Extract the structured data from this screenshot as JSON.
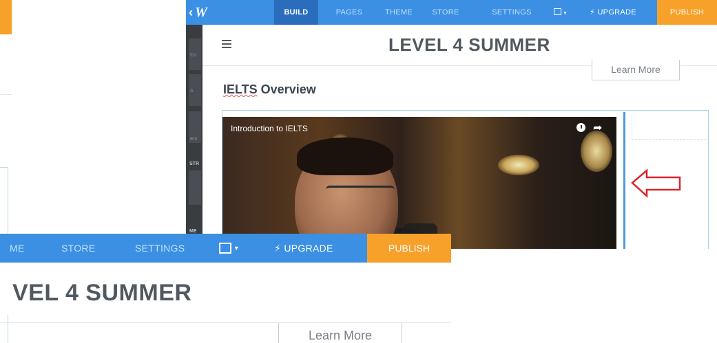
{
  "topbar": {
    "logo": "W",
    "nav": [
      "BUILD",
      "PAGES",
      "THEME",
      "STORE",
      "SETTINGS"
    ],
    "upgrade": "UPGRADE",
    "publish": "PUBLISH",
    "accent": "#3b90e3",
    "publish_color": "#f7a12a"
  },
  "sidebar": {
    "labels": [
      "Co",
      "A",
      "Em"
    ],
    "sections": [
      "STR",
      "ME"
    ]
  },
  "site": {
    "title": "LEVEL 4 SUMMER",
    "learn_more": "Learn More",
    "heading_word": "IELTS",
    "heading_rest": " Overview"
  },
  "video": {
    "title": "Introduction to IELTS"
  },
  "zoom": {
    "nav_theme_fragment": "ME",
    "nav_store": "STORE",
    "nav_settings": "SETTINGS",
    "upgrade": "UPGRADE",
    "publish": "PUBLISH",
    "title_fragment": "VEL 4 SUMMER",
    "learn_more": "Learn More"
  }
}
